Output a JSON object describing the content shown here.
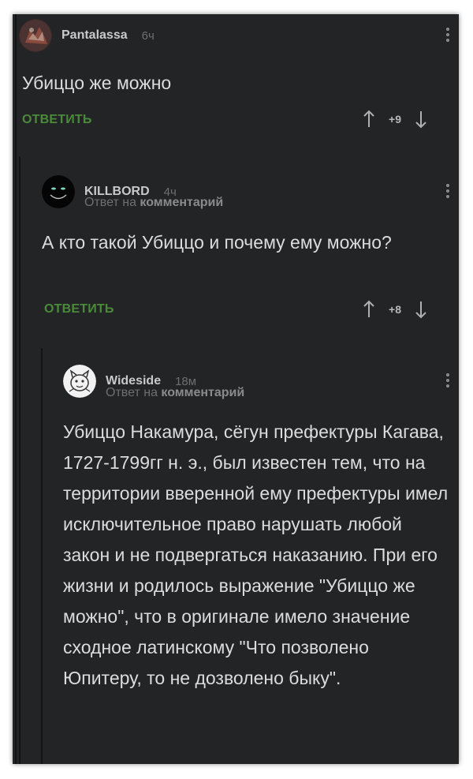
{
  "comments": [
    {
      "author": "Pantalassa",
      "time": "6ч",
      "text": "Убиццо же можно",
      "reply_label": "ОТВЕТИТЬ",
      "score": "+9"
    },
    {
      "author": "KILLBORD",
      "time": "4ч",
      "reply_to_prefix": "Ответ на",
      "reply_to_link": "комментарий",
      "text": "А кто такой Убиццо и почему ему можно?",
      "reply_label": "ОТВЕТИТЬ",
      "score": "+8"
    },
    {
      "author": "Wideside",
      "time": "18м",
      "reply_to_prefix": "Ответ на",
      "reply_to_link": "комментарий",
      "text": "Убиццо Накамура, сёгун префектуры Кагава, 1727-1799гг н. э., был известен тем, что на территории вверенной ему префектуры имел исключительное право нарушать любой закон и не подвергаться наказанию. При его жизни и родилось выражение \"Убиццо же можно\", что в оригинале имело значение сходное латинскому \"Что позволено Юпитеру, то не дозволено быку\"."
    }
  ],
  "colors": {
    "background": "#232425",
    "reply_green": "#4b8a3b",
    "text": "#dcdcdc"
  }
}
